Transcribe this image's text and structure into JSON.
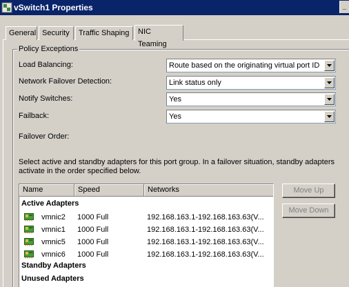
{
  "window": {
    "title": "vSwitch1 Properties"
  },
  "tabs": [
    {
      "label": "General"
    },
    {
      "label": "Security"
    },
    {
      "label": "Traffic Shaping"
    },
    {
      "label": "NIC Teaming"
    }
  ],
  "policy": {
    "legend": "Policy Exceptions",
    "load_balancing": {
      "label": "Load Balancing:",
      "value": "Route based on the originating virtual port ID"
    },
    "failover_detection": {
      "label": "Network Failover Detection:",
      "value": "Link status only"
    },
    "notify_switches": {
      "label": "Notify Switches:",
      "value": "Yes"
    },
    "failback": {
      "label": "Failback:",
      "value": "Yes"
    },
    "failover_order": {
      "label": "Failover Order:"
    },
    "description": "Select active and standby adapters for this port group.  In a failover situation, standby adapters activate  in the order specified below."
  },
  "adapters": {
    "columns": [
      "Name",
      "Speed",
      "Networks"
    ],
    "active_label": "Active Adapters",
    "active": [
      {
        "name": "vmnic2",
        "speed": "1000 Full",
        "networks": "192.168.163.1-192.168.163.63(V..."
      },
      {
        "name": "vmnic1",
        "speed": "1000 Full",
        "networks": "192.168.163.1-192.168.163.63(V..."
      },
      {
        "name": "vmnic5",
        "speed": "1000 Full",
        "networks": "192.168.163.1-192.168.163.63(V..."
      },
      {
        "name": "vmnic6",
        "speed": "1000 Full",
        "networks": "192.168.163.1-192.168.163.63(V..."
      }
    ],
    "standby_label": "Standby Adapters",
    "unused_label": "Unused Adapters"
  },
  "buttons": {
    "move_up": "Move Up",
    "move_down": "Move Down"
  },
  "colors": {
    "title_bar": "#0a246a",
    "dialog_bg": "#d4d0c8",
    "disabled_text": "#808080"
  },
  "icons": {
    "app": "vsphere-app-icon",
    "adapter": "network-adapter-icon",
    "dropdown": "dropdown-arrow-icon"
  }
}
